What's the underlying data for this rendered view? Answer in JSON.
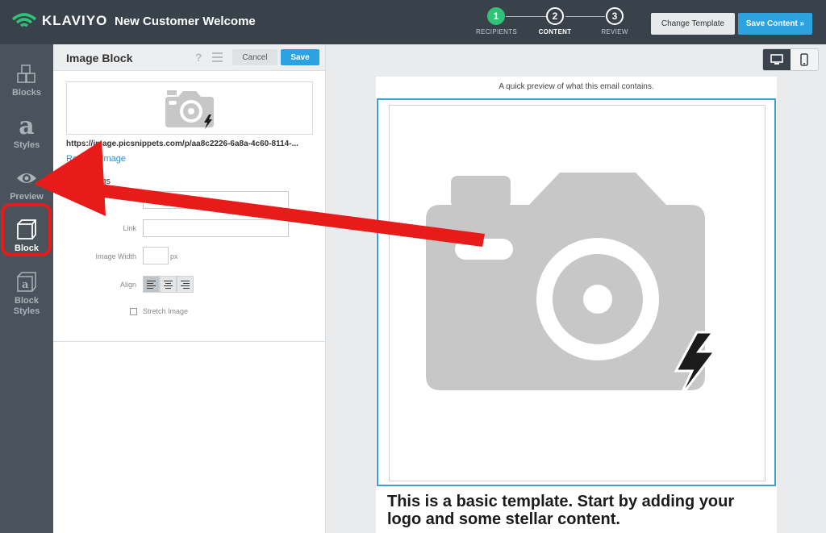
{
  "header": {
    "brand": "KLAVIYO",
    "campaign_title": "New Customer Welcome",
    "steps": [
      {
        "num": "1",
        "label": "RECIPIENTS",
        "state": "done"
      },
      {
        "num": "2",
        "label": "CONTENT",
        "state": "current"
      },
      {
        "num": "3",
        "label": "REVIEW",
        "state": "todo"
      }
    ],
    "change_template_label": "Change Template",
    "save_content_label": "Save Content »"
  },
  "sidebar": {
    "items": [
      {
        "label": "Blocks"
      },
      {
        "label": "Styles"
      },
      {
        "label": "Preview"
      },
      {
        "label": "Block"
      },
      {
        "label": "Block\nStyles"
      }
    ]
  },
  "editor": {
    "title": "Image Block",
    "help_glyph": "?",
    "cancel_label": "Cancel",
    "save_label": "Save",
    "image_url": "https://image.picsnippets.com/p/aa8c2226-6a8a-4c60-8114-...",
    "replace_label": "Replace Image",
    "settings_heading": "ge Settings",
    "link_label": "Link",
    "width_label": "Image Width",
    "width_unit": "px",
    "align_label": "Align",
    "stretch_label": "Stretch Image"
  },
  "preview": {
    "note": "A quick preview of what this email contains.",
    "body_text": "This is a basic template. Start by adding your logo and some stellar content."
  },
  "colors": {
    "topbar": "#39414b",
    "sidebar": "#4a525c",
    "accent": "#2da2e0",
    "step_done": "#2fc378",
    "annotation_red": "#e81b1b"
  }
}
